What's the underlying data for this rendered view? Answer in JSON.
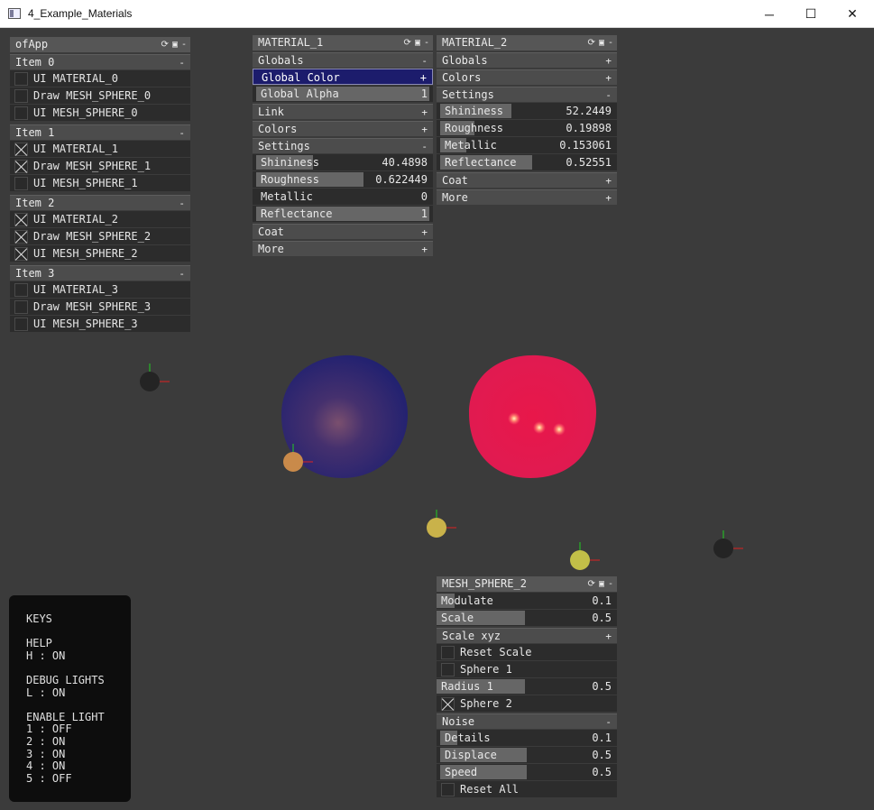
{
  "window": {
    "title": "4_Example_Materials",
    "minimize": "─",
    "maximize": "☐",
    "close": "✕"
  },
  "ofapp": {
    "title": "ofApp",
    "items": [
      {
        "label": "Item 0",
        "sign": "-",
        "rows": [
          {
            "label": "UI MATERIAL_0",
            "checked": false
          },
          {
            "label": "Draw MESH_SPHERE_0",
            "checked": false
          },
          {
            "label": "UI MESH_SPHERE_0",
            "checked": false
          }
        ]
      },
      {
        "label": "Item 1",
        "sign": "-",
        "rows": [
          {
            "label": "UI MATERIAL_1",
            "checked": true
          },
          {
            "label": "Draw MESH_SPHERE_1",
            "checked": true
          },
          {
            "label": "UI MESH_SPHERE_1",
            "checked": false
          }
        ]
      },
      {
        "label": "Item 2",
        "sign": "-",
        "rows": [
          {
            "label": "UI MATERIAL_2",
            "checked": true
          },
          {
            "label": "Draw MESH_SPHERE_2",
            "checked": true
          },
          {
            "label": "UI MESH_SPHERE_2",
            "checked": true
          }
        ]
      },
      {
        "label": "Item 3",
        "sign": "-",
        "rows": [
          {
            "label": "UI MATERIAL_3",
            "checked": false
          },
          {
            "label": "Draw MESH_SPHERE_3",
            "checked": false
          },
          {
            "label": "UI MESH_SPHERE_3",
            "checked": false
          }
        ]
      }
    ]
  },
  "material1": {
    "title": "MATERIAL_1",
    "globals": "Globals",
    "global_color": "Global Color",
    "global_alpha": {
      "label": "Global Alpha",
      "value": "1",
      "fraction": 1
    },
    "link": "Link",
    "colors": "Colors",
    "settings": "Settings",
    "shininess": {
      "label": "Shininess",
      "value": "40.4898",
      "fraction": 0.33
    },
    "roughness": {
      "label": "Roughness",
      "value": "0.622449",
      "fraction": 0.62
    },
    "metallic": {
      "label": "Metallic",
      "value": "0",
      "fraction": 0
    },
    "reflectance": {
      "label": "Reflectance",
      "value": "1",
      "fraction": 1
    },
    "coat": "Coat",
    "more": "More"
  },
  "material2": {
    "title": "MATERIAL_2",
    "globals": "Globals",
    "colors": "Colors",
    "settings": "Settings",
    "shininess": {
      "label": "Shininess",
      "value": "52.2449",
      "fraction": 0.41
    },
    "roughness": {
      "label": "Roughness",
      "value": "0.19898",
      "fraction": 0.2
    },
    "metallic": {
      "label": "Metallic",
      "value": "0.153061",
      "fraction": 0.15
    },
    "reflectance": {
      "label": "Reflectance",
      "value": "0.52551",
      "fraction": 0.53
    },
    "coat": "Coat",
    "more": "More"
  },
  "mesh": {
    "title": "MESH_SPHERE_2",
    "modulate": {
      "label": "Modulate",
      "value": "0.1",
      "fraction": 0.1
    },
    "scale": {
      "label": "Scale",
      "value": "0.5",
      "fraction": 0.5
    },
    "scale_xyz": "Scale xyz",
    "reset_scale": "Reset Scale",
    "sphere1": "Sphere 1",
    "radius1": {
      "label": "Radius 1",
      "value": "0.5",
      "fraction": 0.5
    },
    "sphere2": "Sphere 2",
    "noise": "Noise",
    "details": {
      "label": "Details",
      "value": "0.1",
      "fraction": 0.1
    },
    "displace": {
      "label": "Displace",
      "value": "0.5",
      "fraction": 0.5
    },
    "speed": {
      "label": "Speed",
      "value": "0.5",
      "fraction": 0.5
    },
    "reset_all": "Reset All"
  },
  "keys": {
    "title": "KEYS",
    "help_title": "HELP",
    "help": "H : ON",
    "debug_title": "DEBUG LIGHTS",
    "debug": "L : ON",
    "enable_title": "ENABLE LIGHT",
    "lights": [
      "1 : OFF",
      "2 : ON",
      "3 : ON",
      "4 : ON",
      "5 : OFF"
    ]
  },
  "colors": {
    "background": "#3b3b3b",
    "sphere1": "#232370",
    "sphere2": "#e0194e",
    "selection": "#1c1c6c"
  }
}
